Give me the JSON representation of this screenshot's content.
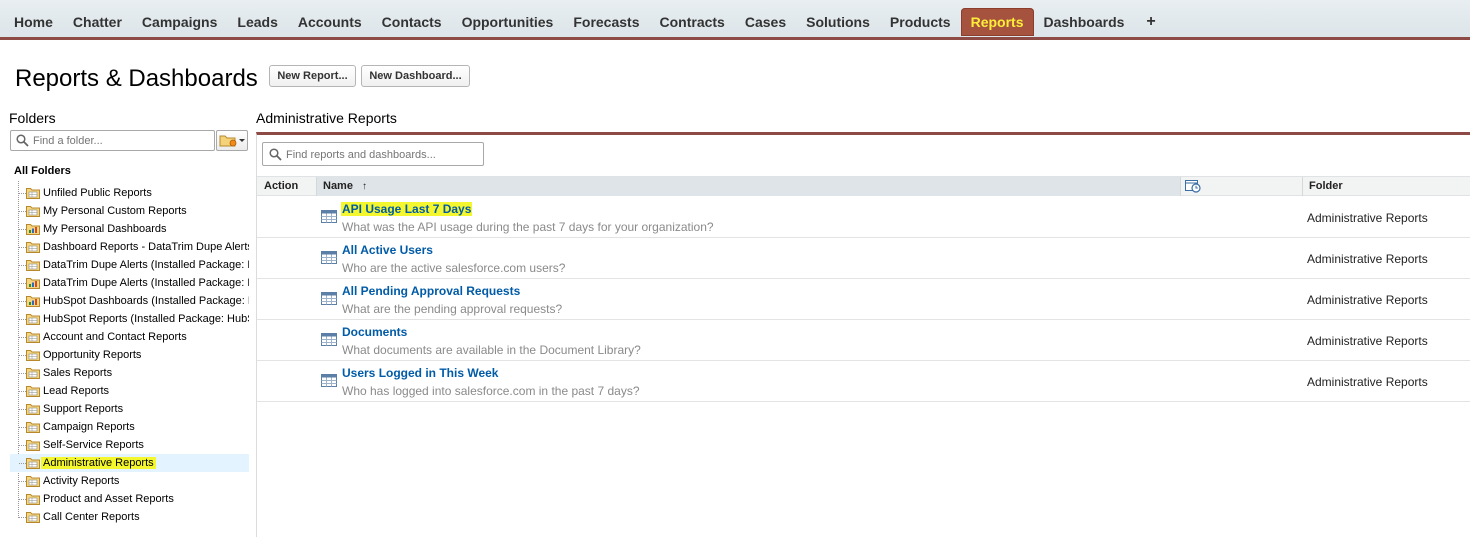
{
  "nav": {
    "tabs": [
      {
        "label": "Home"
      },
      {
        "label": "Chatter"
      },
      {
        "label": "Campaigns"
      },
      {
        "label": "Leads"
      },
      {
        "label": "Accounts"
      },
      {
        "label": "Contacts"
      },
      {
        "label": "Opportunities"
      },
      {
        "label": "Forecasts"
      },
      {
        "label": "Contracts"
      },
      {
        "label": "Cases"
      },
      {
        "label": "Solutions"
      },
      {
        "label": "Products"
      },
      {
        "label": "Reports",
        "active": true
      },
      {
        "label": "Dashboards"
      }
    ],
    "plus_label": "+",
    "active_color": "#a5523f",
    "active_text_color": "#ffee38"
  },
  "header": {
    "title": "Reports & Dashboards",
    "new_report_label": "New Report...",
    "new_dashboard_label": "New Dashboard..."
  },
  "sidebar": {
    "title": "Folders",
    "search_placeholder": "Find a folder...",
    "all_folders_label": "All Folders",
    "folders": [
      {
        "label": "Unfiled Public Reports",
        "icon": "report-folder-icon"
      },
      {
        "label": "My Personal Custom Reports",
        "icon": "report-folder-icon"
      },
      {
        "label": "My Personal Dashboards",
        "icon": "dashboard-folder-icon"
      },
      {
        "label": "Dashboard Reports - DataTrim Dupe Alerts",
        "icon": "report-folder-icon"
      },
      {
        "label": "DataTrim Dupe Alerts (Installed Package: D",
        "icon": "report-folder-icon"
      },
      {
        "label": "DataTrim Dupe Alerts (Installed Package: D",
        "icon": "dashboard-folder-icon"
      },
      {
        "label": "HubSpot Dashboards (Installed Package: H",
        "icon": "dashboard-folder-icon"
      },
      {
        "label": "HubSpot Reports (Installed Package: HubSp",
        "icon": "report-folder-icon"
      },
      {
        "label": "Account and Contact Reports",
        "icon": "report-folder-icon"
      },
      {
        "label": "Opportunity Reports",
        "icon": "report-folder-icon"
      },
      {
        "label": "Sales Reports",
        "icon": "report-folder-icon"
      },
      {
        "label": "Lead Reports",
        "icon": "report-folder-icon"
      },
      {
        "label": "Support Reports",
        "icon": "report-folder-icon"
      },
      {
        "label": "Campaign Reports",
        "icon": "report-folder-icon"
      },
      {
        "label": "Self-Service Reports",
        "icon": "report-folder-icon"
      },
      {
        "label": "Administrative Reports",
        "icon": "report-folder-icon",
        "selected": true
      },
      {
        "label": "Activity Reports",
        "icon": "report-folder-icon"
      },
      {
        "label": "Product and Asset Reports",
        "icon": "report-folder-icon"
      },
      {
        "label": "Call Center Reports",
        "icon": "report-folder-icon"
      }
    ],
    "highlight_color": "#f4f72e"
  },
  "main": {
    "title": "Administrative Reports",
    "search_placeholder": "Find reports and dashboards...",
    "columns": {
      "action": "Action",
      "name": "Name",
      "sort_indicator": "↑",
      "schedule_icon": "schedule-clock-icon",
      "folder": "Folder"
    },
    "rows": [
      {
        "name": "API Usage Last 7 Days",
        "description": "What was the API usage during the past 7 days for your organization?",
        "folder": "Administrative Reports",
        "highlighted": true
      },
      {
        "name": "All Active Users",
        "description": "Who are the active salesforce.com users?",
        "folder": "Administrative Reports"
      },
      {
        "name": "All Pending Approval Requests",
        "description": "What are the pending approval requests?",
        "folder": "Administrative Reports"
      },
      {
        "name": "Documents",
        "description": "What documents are available in the Document Library?",
        "folder": "Administrative Reports"
      },
      {
        "name": "Users Logged in This Week",
        "description": "Who has logged into salesforce.com in the past 7 days?",
        "folder": "Administrative Reports"
      }
    ],
    "link_color": "#015ba7",
    "accent_border_color": "#8e4a44"
  }
}
